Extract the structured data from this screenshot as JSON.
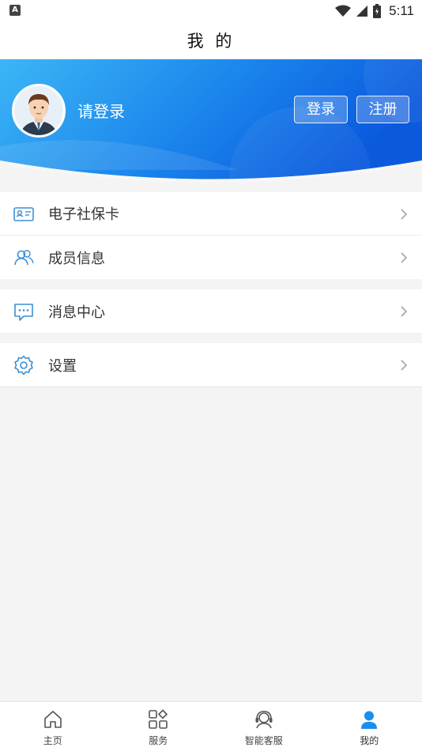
{
  "status_bar": {
    "time": "5:11"
  },
  "header": {
    "title": "我 的"
  },
  "profile": {
    "login_prompt": "请登录",
    "login_button": "登录",
    "register_button": "注册"
  },
  "menu": {
    "group1": [
      {
        "label": "电子社保卡",
        "icon": "id-card-icon"
      },
      {
        "label": "成员信息",
        "icon": "members-icon"
      }
    ],
    "group2": [
      {
        "label": "消息中心",
        "icon": "message-icon"
      }
    ],
    "group3": [
      {
        "label": "设置",
        "icon": "gear-icon"
      }
    ]
  },
  "tabs": [
    {
      "label": "主页",
      "icon": "home-icon"
    },
    {
      "label": "服务",
      "icon": "services-grid-icon"
    },
    {
      "label": "智能客服",
      "icon": "customer-service-icon"
    },
    {
      "label": "我的",
      "icon": "user-icon",
      "active": true
    }
  ],
  "colors": {
    "accent": "#1a8ff0",
    "banner_start": "#36b0f4",
    "banner_end": "#0c5fe0",
    "icon_blue": "#3a8fd8"
  }
}
